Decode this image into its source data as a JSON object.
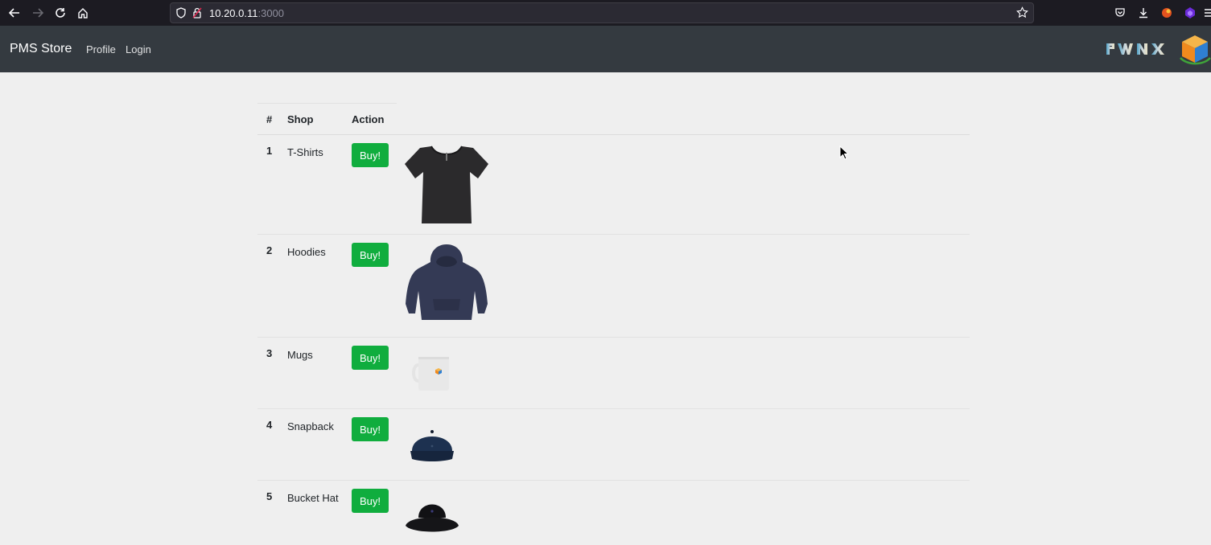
{
  "browser": {
    "url_host": "10.20.0.11",
    "url_port": ":3000"
  },
  "navbar": {
    "brand": "PMS Store",
    "links": [
      "Profile",
      "Login"
    ],
    "logo_text": "PWNX"
  },
  "table": {
    "headers": [
      "#",
      "Shop",
      "Action"
    ],
    "rows": [
      {
        "num": "1",
        "name": "T-Shirts",
        "action": "Buy!",
        "image": "t-shirt-icon"
      },
      {
        "num": "2",
        "name": "Hoodies",
        "action": "Buy!",
        "image": "hoodie-icon"
      },
      {
        "num": "3",
        "name": "Mugs",
        "action": "Buy!",
        "image": "mug-icon"
      },
      {
        "num": "4",
        "name": "Snapback",
        "action": "Buy!",
        "image": "snapback-cap-icon"
      },
      {
        "num": "5",
        "name": "Bucket Hat",
        "action": "Buy!",
        "image": "bucket-hat-icon"
      }
    ]
  },
  "colors": {
    "navbar_bg": "#343a40",
    "buy_button": "#10ad3e",
    "page_bg": "#efefef"
  }
}
